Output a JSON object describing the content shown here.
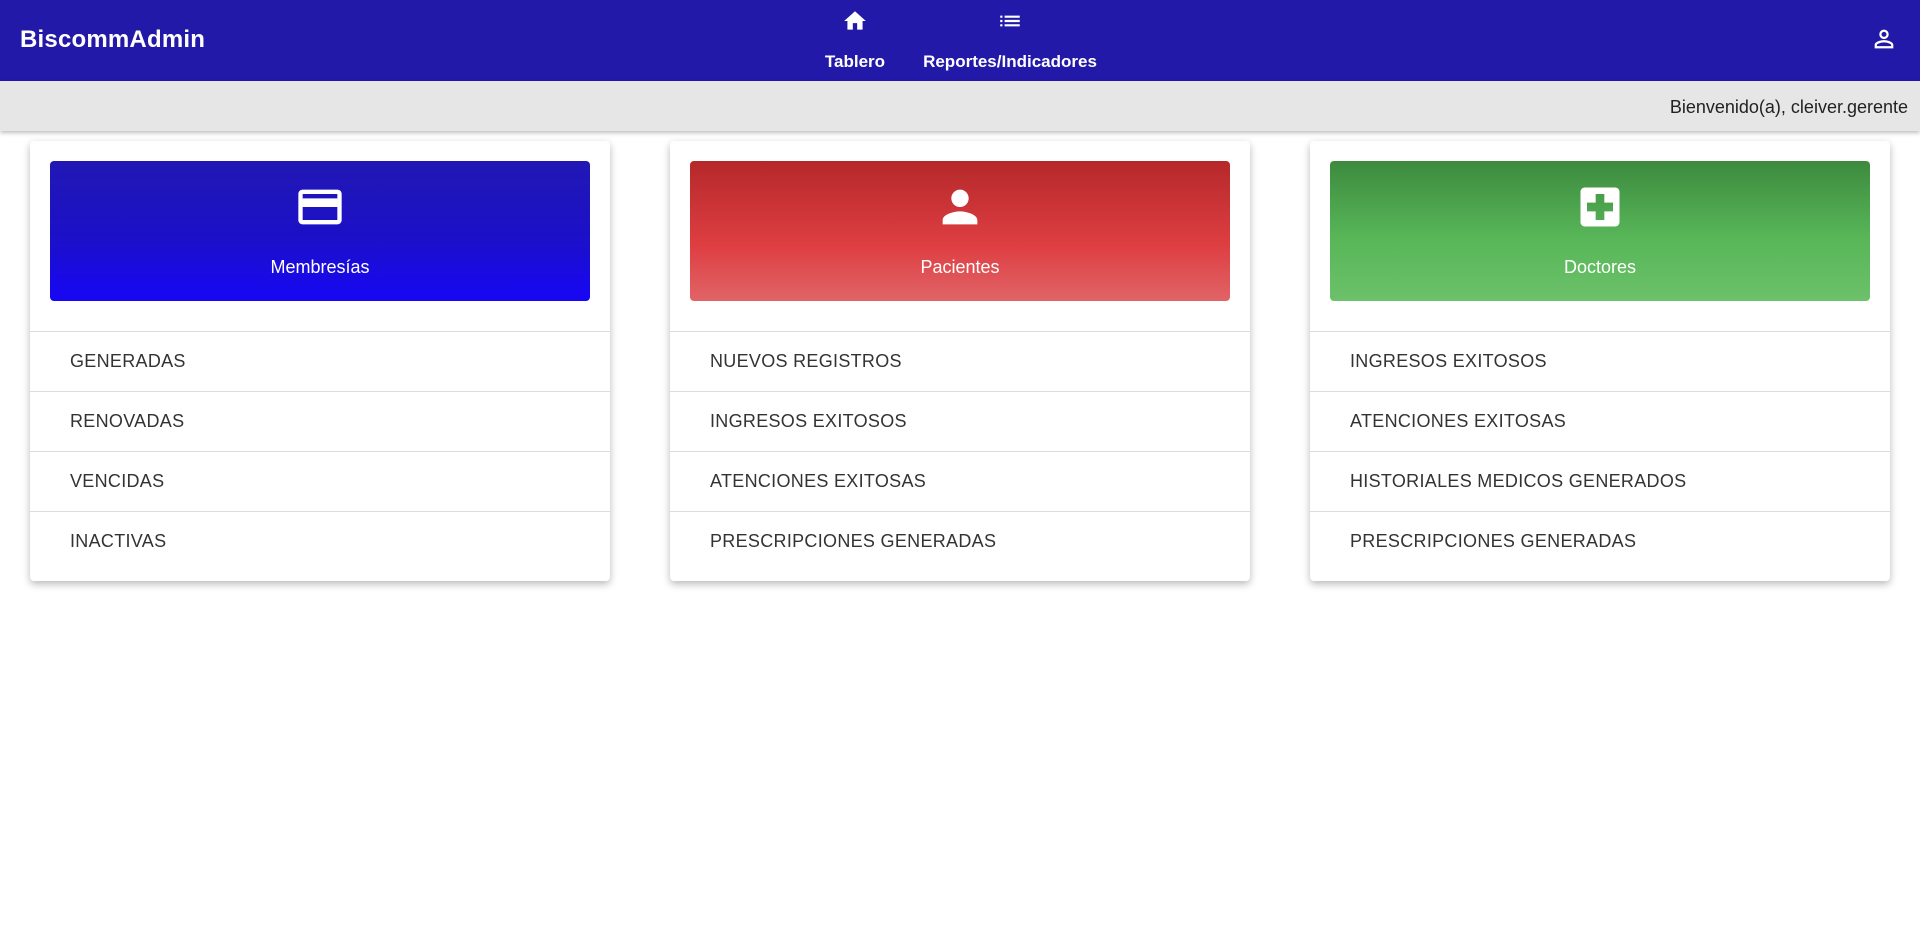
{
  "app": {
    "title": "BiscommAdmin"
  },
  "nav": {
    "items": [
      {
        "label": "Tablero",
        "icon": "home-icon"
      },
      {
        "label": "Reportes/Indicadores",
        "icon": "list-icon"
      }
    ],
    "user_icon": "account-icon"
  },
  "welcome": {
    "text": "Bienvenido(a), cleiver.gerente"
  },
  "cards": [
    {
      "title": "Membresías",
      "icon": "credit-card-icon",
      "color": "#1a0ce0",
      "items": [
        "GENERADAS",
        "RENOVADAS",
        "VENCIDAS",
        "INACTIVAS"
      ]
    },
    {
      "title": "Pacientes",
      "icon": "person-icon",
      "color": "#dc3c40",
      "items": [
        "NUEVOS REGISTROS",
        "INGRESOS EXITOSOS",
        "ATENCIONES EXITOSAS",
        "PRESCRIPCIONES GENERADAS"
      ]
    },
    {
      "title": "Doctores",
      "icon": "medical-cross-icon",
      "color": "#58b658",
      "items": [
        "INGRESOS EXITOSOS",
        "ATENCIONES EXITOSAS",
        "HISTORIALES MEDICOS GENERADOS",
        "PRESCRIPCIONES GENERADAS"
      ]
    }
  ],
  "colors": {
    "topbar": "#2319a8",
    "welcome_bar": "#e6e6e6"
  }
}
